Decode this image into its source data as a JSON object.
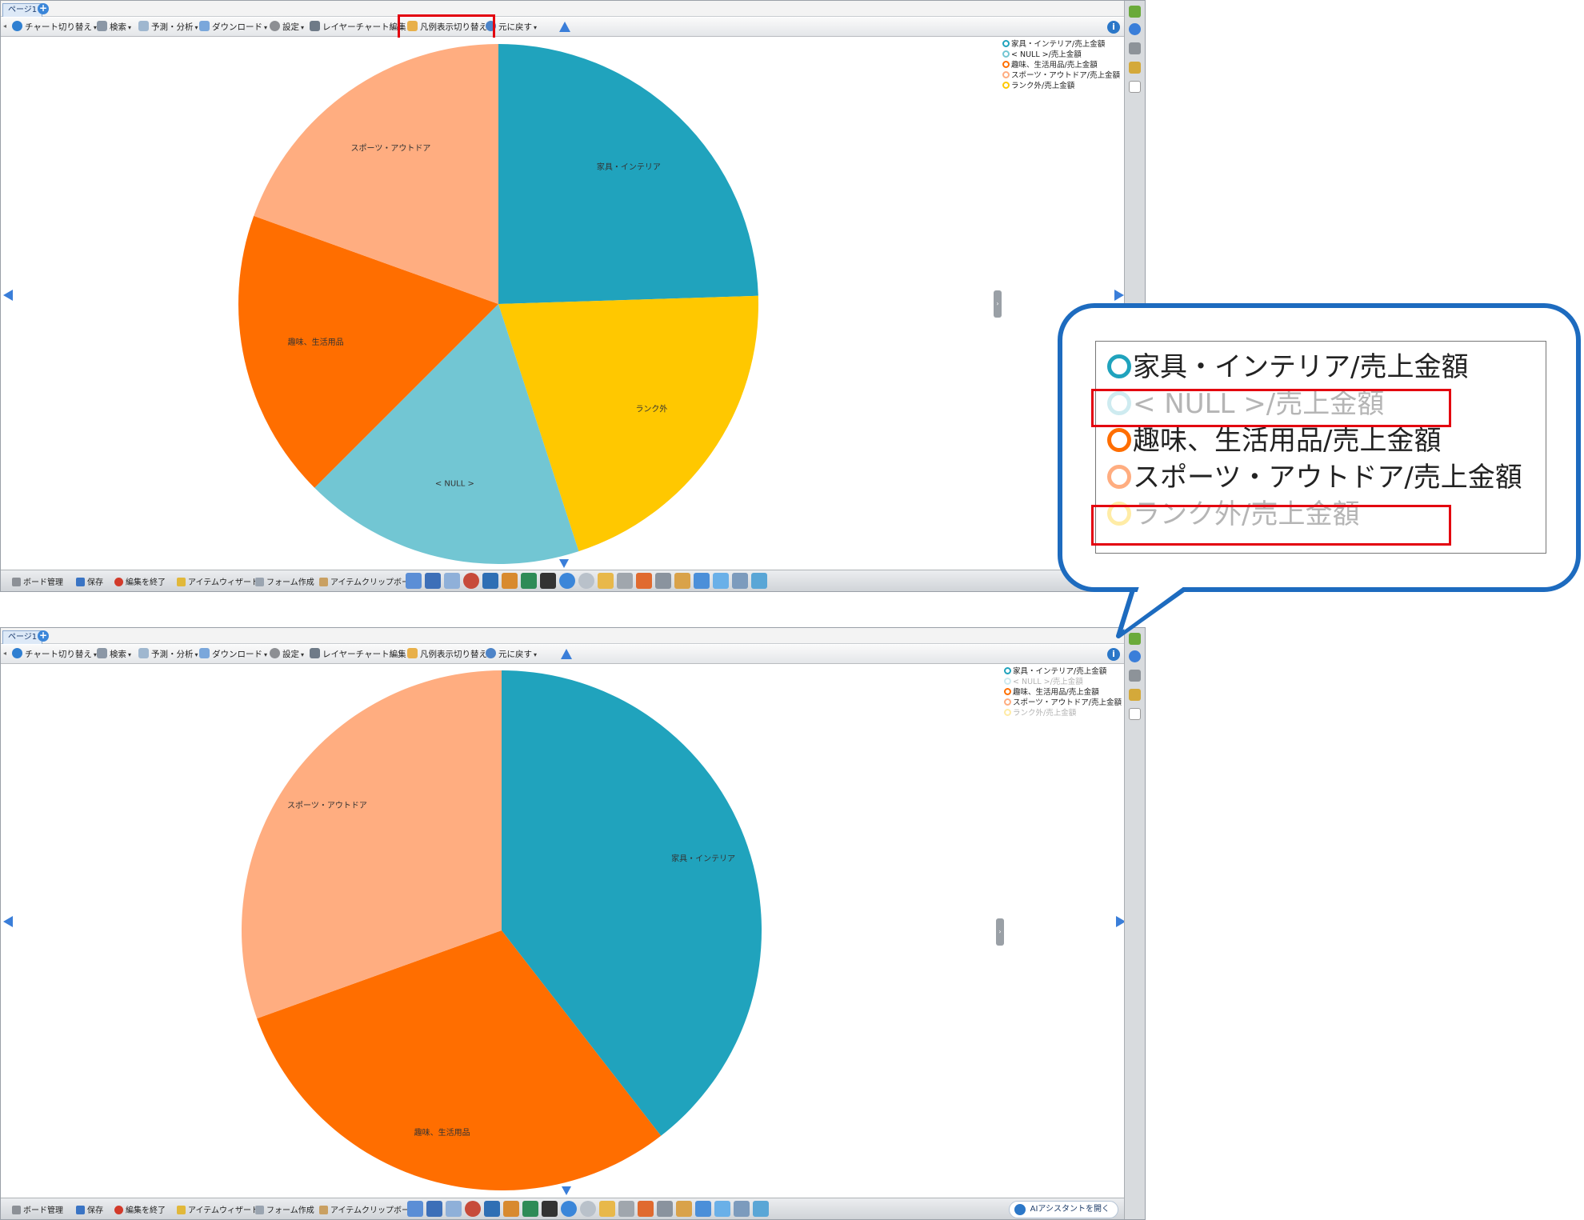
{
  "tabs": {
    "page_label": "ページ1",
    "add_label": "+"
  },
  "toolbar": {
    "chart_switch": "チャート切り替え",
    "search": "検索",
    "forecast": "予測・分析",
    "download": "ダウンロード",
    "settings": "設定",
    "layer_edit": "レイヤーチャート編集",
    "legend_toggle": "凡例表示切り替え",
    "revert": "元に戻す",
    "info": "i"
  },
  "bottombar": {
    "board": "ボード管理",
    "save": "保存",
    "end_edit": "編集を終了",
    "wizard": "アイテムウィザード",
    "form": "フォーム作成",
    "clipboard": "アイテムクリップボード",
    "ai_assistant": "AIアシスタントを開く"
  },
  "legend": [
    {
      "label": "家具・インテリア/売上金額",
      "color": "#20a3bd"
    },
    {
      "label": "< NULL >/売上金額",
      "color": "#72c6d3"
    },
    {
      "label": "趣味、生活用品/売上金額",
      "color": "#ff6e00"
    },
    {
      "label": "スポーツ・アウトドア/売上金額",
      "color": "#ffad80"
    },
    {
      "label": "ランク外/売上金額",
      "color": "#ffc800"
    }
  ],
  "chart_data": [
    {
      "type": "pie",
      "panel": "before",
      "slices": [
        {
          "label": "家具・インテリア",
          "value": 24.5,
          "color": "#20a3bd"
        },
        {
          "label": "ランク外",
          "value": 20.5,
          "color": "#ffc800"
        },
        {
          "label": "< NULL >",
          "value": 17.5,
          "color": "#72c6d3"
        },
        {
          "label": "趣味、生活用品",
          "value": 18.0,
          "color": "#ff6e00"
        },
        {
          "label": "スポーツ・アウトドア",
          "value": 19.5,
          "color": "#ffad80"
        }
      ]
    },
    {
      "type": "pie",
      "panel": "after",
      "hidden": [
        "< NULL >",
        "ランク外"
      ],
      "slices": [
        {
          "label": "家具・インテリア",
          "value": 39.5,
          "color": "#20a3bd"
        },
        {
          "label": "趣味、生活用品",
          "value": 30.0,
          "color": "#ff6e00"
        },
        {
          "label": "スポーツ・アウトドア",
          "value": 30.5,
          "color": "#ffad80"
        }
      ]
    }
  ]
}
